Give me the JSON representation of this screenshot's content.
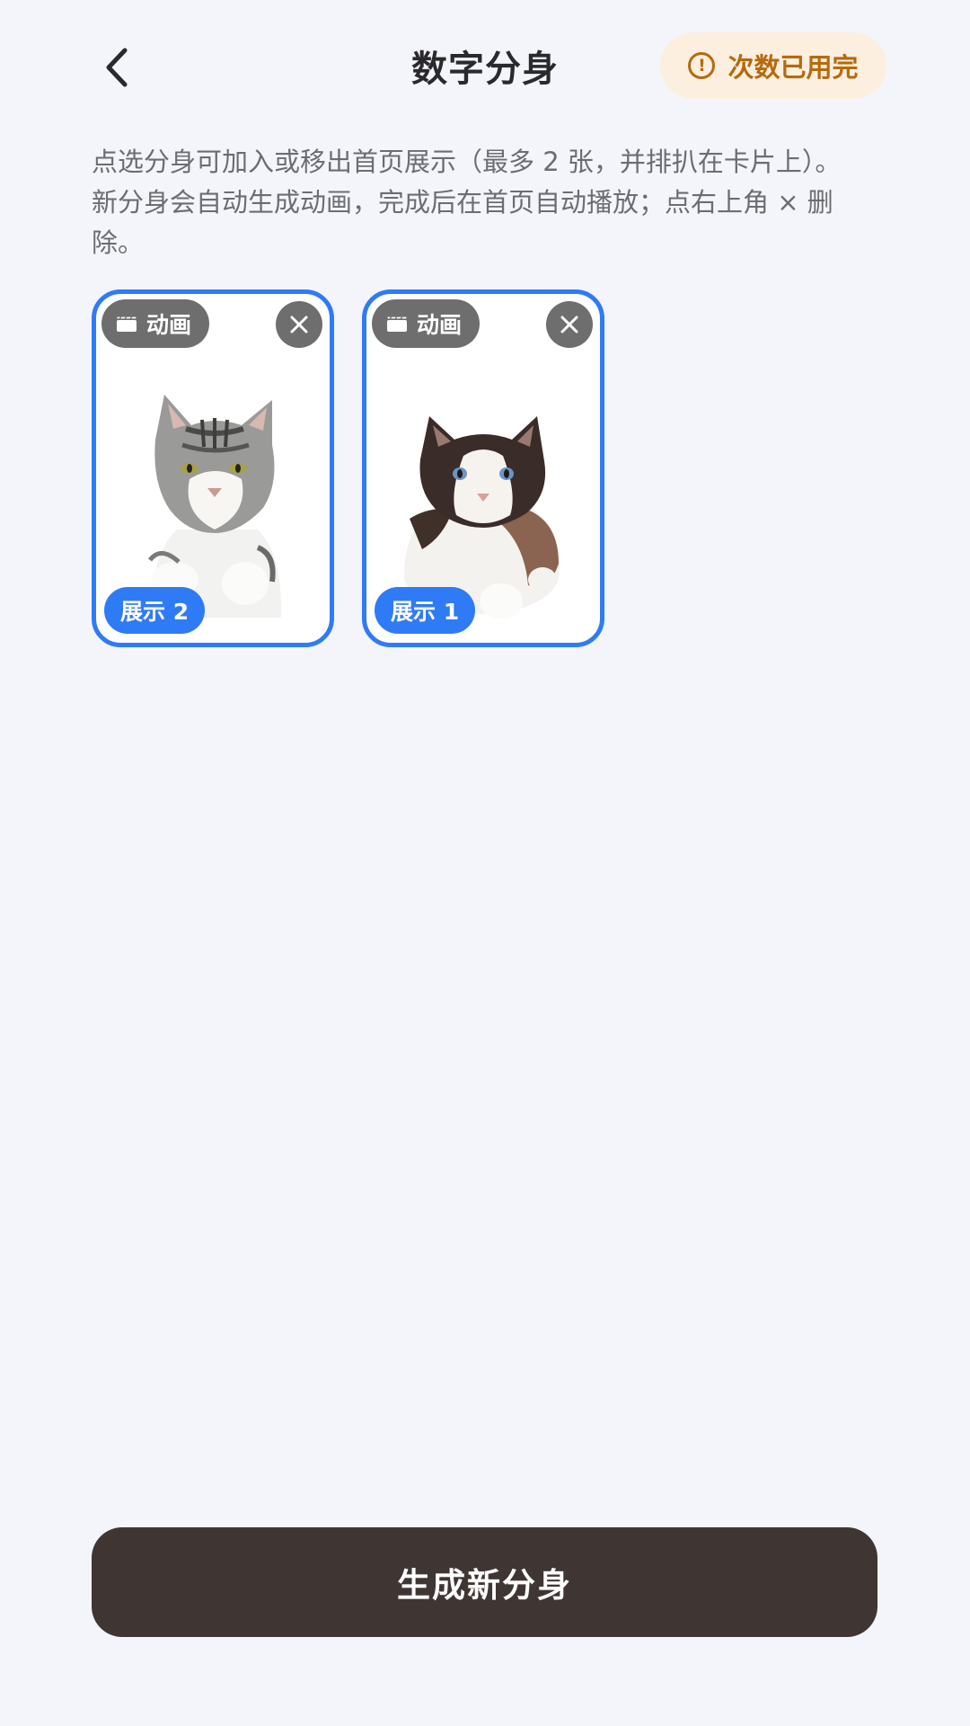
{
  "header": {
    "title": "数字分身",
    "status_label": "次数已用完"
  },
  "description": "点选分身可加入或移出首页展示（最多 2 张，并排扒在卡片上）。新分身会自动生成动画，完成后在首页自动播放；点右上角 × 删除。",
  "cards": [
    {
      "anim_label": "动画",
      "display_label": "展示 2",
      "selected": true,
      "subject": "gray tabby and white cat"
    },
    {
      "anim_label": "动画",
      "display_label": "展示 1",
      "selected": true,
      "subject": "ragdoll cat"
    }
  ],
  "generate_button_label": "生成新分身",
  "colors": {
    "accent": "#2f7bf5",
    "primary_button": "#3f3634",
    "warning_bg": "#fcefdf",
    "warning_text": "#b56a0e",
    "badge_gray": "#6e6e6e",
    "background": "#f3f5fa"
  },
  "icons": {
    "back": "chevron-left-icon",
    "warning": "exclamation-circle-icon",
    "animation": "clapperboard-icon",
    "delete": "close-icon"
  }
}
